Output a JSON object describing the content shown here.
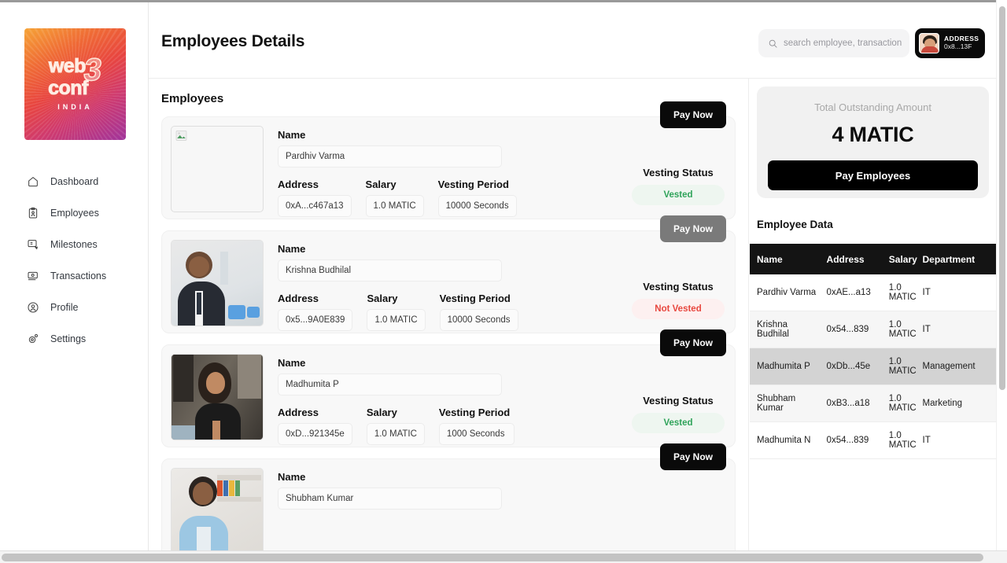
{
  "sidebar": {
    "logo": {
      "word1": "web",
      "word2": "conf",
      "numeral": "3",
      "sub": "INDIA"
    },
    "items": [
      {
        "label": "Dashboard",
        "icon": "home-icon"
      },
      {
        "label": "Employees",
        "icon": "clipboard-user-icon"
      },
      {
        "label": "Milestones",
        "icon": "milestone-icon"
      },
      {
        "label": "Transactions",
        "icon": "banknote-icon"
      },
      {
        "label": "Profile",
        "icon": "user-circle-icon"
      },
      {
        "label": "Settings",
        "icon": "gear-icon"
      }
    ]
  },
  "header": {
    "title": "Employees Details",
    "search": {
      "placeholder": "search employee, transactions..",
      "value": ""
    },
    "address_chip": {
      "label": "ADDRESS",
      "value": "0x8...13F"
    }
  },
  "main": {
    "section_title": "Employees",
    "field_labels": {
      "name": "Name",
      "address": "Address",
      "salary": "Salary",
      "vesting_period": "Vesting Period",
      "vesting_status": "Vesting Status"
    },
    "pay_now_label": "Pay Now",
    "employees": [
      {
        "name": "Pardhiv Varma",
        "address": "0xA...c467a13",
        "salary": "1.0 MATIC",
        "vesting_period": "10000 Seconds",
        "vesting_status": "Vested",
        "status_kind": "vested",
        "pay_enabled": true,
        "photo": "broken"
      },
      {
        "name": "Krishna Budhilal",
        "address": "0x5...9A0E839",
        "salary": "1.0 MATIC",
        "vesting_period": "10000 Seconds",
        "vesting_status": "Not Vested",
        "status_kind": "not-vested",
        "pay_enabled": false,
        "photo": "man-suit"
      },
      {
        "name": "Madhumita P",
        "address": "0xD...921345e",
        "salary": "1.0 MATIC",
        "vesting_period": "1000 Seconds",
        "vesting_status": "Vested",
        "status_kind": "vested",
        "pay_enabled": true,
        "photo": "woman"
      },
      {
        "name": "Shubham Kumar",
        "address": "",
        "salary": "",
        "vesting_period": "",
        "vesting_status": "",
        "status_kind": "",
        "pay_enabled": true,
        "photo": "man-shelf"
      }
    ]
  },
  "right_panel": {
    "outstanding_label": "Total Outstanding Amount",
    "outstanding_amount": "4 MATIC",
    "pay_employees_label": "Pay Employees",
    "employee_data_title": "Employee Data",
    "table": {
      "columns": [
        "Name",
        "Address",
        "Salary",
        "Department"
      ],
      "rows": [
        {
          "name": "Pardhiv Varma",
          "address": "0xAE...a13",
          "salary": "1.0 MATIC",
          "department": "IT"
        },
        {
          "name": "Krishna Budhilal",
          "address": "0x54...839",
          "salary": "1.0 MATIC",
          "department": "IT"
        },
        {
          "name": "Madhumita P",
          "address": "0xDb...45e",
          "salary": "1.0 MATIC",
          "department": "Management"
        },
        {
          "name": "Shubham Kumar",
          "address": "0xB3...a18",
          "salary": "1.0 MATIC",
          "department": "Marketing"
        },
        {
          "name": "Madhumita N",
          "address": "0x54...839",
          "salary": "1.0 MATIC",
          "department": "IT"
        }
      ]
    }
  },
  "colors": {
    "accent_black": "#0a0a0a",
    "vested_green": "#2fa35a",
    "not_vested_red": "#e8473f",
    "panel_gray": "#f1f1f1"
  }
}
